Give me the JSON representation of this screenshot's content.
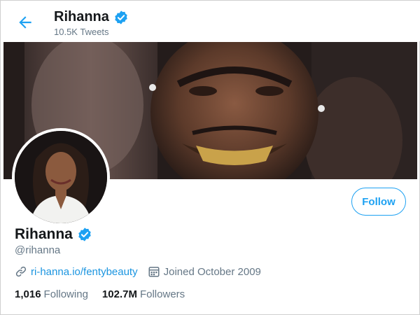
{
  "header": {
    "name": "Rihanna",
    "tweet_count": "10.5K Tweets"
  },
  "profile": {
    "name": "Rihanna",
    "handle": "@rihanna",
    "link": "ri-hanna.io/fentybeauty",
    "joined": "Joined October 2009",
    "following_count": "1,016",
    "following_label": "Following",
    "followers_count": "102.7M",
    "followers_label": "Followers"
  },
  "actions": {
    "follow_label": "Follow"
  },
  "colors": {
    "accent": "#1da1f2",
    "verified": "#1da1f2",
    "text_secondary": "#657786"
  },
  "icons": {
    "back": "arrow-left-icon",
    "verified": "verified-badge-icon",
    "link": "link-icon",
    "calendar": "calendar-icon"
  }
}
